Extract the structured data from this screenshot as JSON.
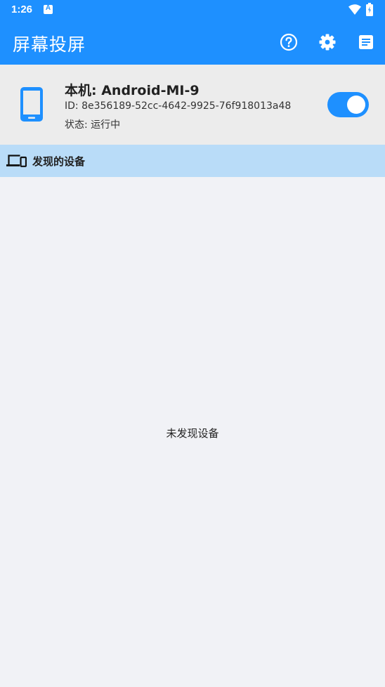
{
  "status_bar": {
    "time": "1:26",
    "notification_letter": "A"
  },
  "app_bar": {
    "title": "屏幕投屏",
    "icons": [
      "help-icon",
      "settings-icon",
      "log-icon"
    ]
  },
  "device": {
    "name": "本机: Android-MI-9",
    "id": "ID: 8e356189-52cc-4642-9925-76f918013a48",
    "status": "状态: 运行中",
    "enabled": true
  },
  "section": {
    "title": "发现的设备"
  },
  "empty_state": {
    "text": "未发现设备"
  },
  "colors": {
    "primary": "#1e90ff",
    "card_bg": "#ececec",
    "section_bg": "#b9dcf8",
    "page_bg": "#f1f2f6"
  }
}
